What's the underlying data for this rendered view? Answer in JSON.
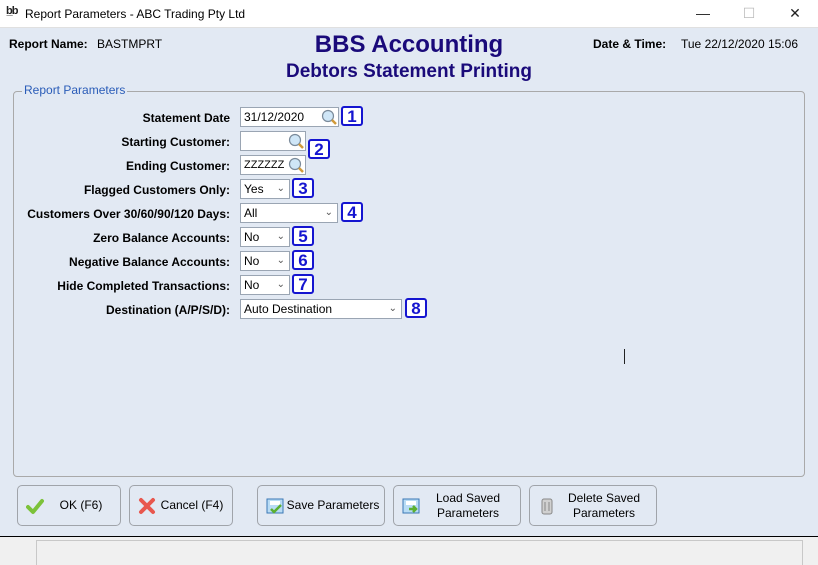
{
  "window": {
    "app_icon": "bbs-logo-icon",
    "title": "Report Parameters - ABC Trading Pty Ltd",
    "minimize": "—",
    "maximize": "☐",
    "close": "✕"
  },
  "header": {
    "report_name_label": "Report Name:",
    "report_name_value": "BASTMPRT",
    "app_title": "BBS Accounting",
    "subtitle": "Debtors Statement Printing",
    "datetime_label": "Date & Time:",
    "datetime_value": "Tue 22/12/2020 15:06"
  },
  "params": {
    "group_title": "Report Parameters",
    "rows": [
      {
        "label": "Statement Date",
        "value": "31/12/2020",
        "kind": "lookup",
        "badge": "1"
      },
      {
        "label": "Starting Customer:",
        "value": "",
        "kind": "lookup",
        "badge": "2"
      },
      {
        "label": "Ending Customer:",
        "value": "ZZZZZZ",
        "kind": "lookup",
        "badge": ""
      },
      {
        "label": "Flagged Customers Only:",
        "value": "Yes",
        "kind": "combo",
        "badge": "3"
      },
      {
        "label": "Customers Over 30/60/90/120 Days:",
        "value": "All",
        "kind": "combo",
        "badge": "4"
      },
      {
        "label": "Zero Balance Accounts:",
        "value": "No",
        "kind": "combo",
        "badge": "5"
      },
      {
        "label": "Negative Balance Accounts:",
        "value": "No",
        "kind": "combo",
        "badge": "6"
      },
      {
        "label": "Hide Completed Transactions:",
        "value": "No",
        "kind": "combo",
        "badge": "7"
      },
      {
        "label": "Destination (A/P/S/D):",
        "value": "Auto Destination",
        "kind": "combo",
        "badge": "8"
      }
    ]
  },
  "buttons": {
    "ok": "OK (F6)",
    "cancel": "Cancel (F4)",
    "save": "Save Parameters",
    "load_1": "Load Saved",
    "load_2": "Parameters",
    "delete_1": "Delete Saved",
    "delete_2": "Parameters"
  },
  "colors": {
    "title_color": "#1a0a7a",
    "badge_color": "#1515d0",
    "group_title_color": "#2a5cb8",
    "background": "#e2e9f3"
  }
}
